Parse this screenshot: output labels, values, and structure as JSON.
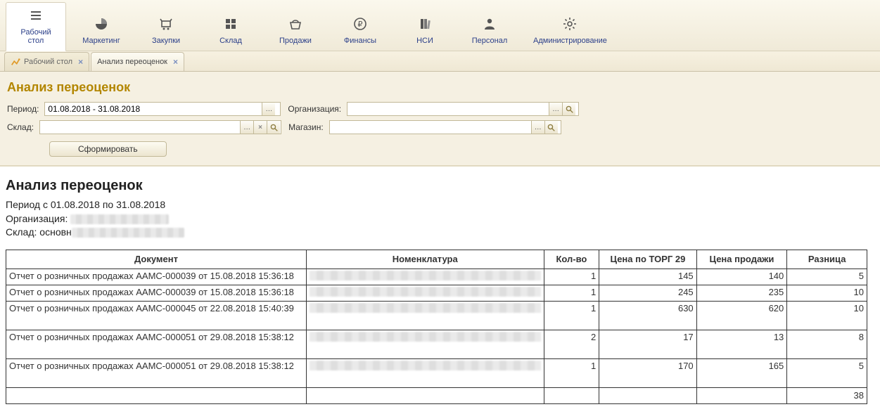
{
  "toolbar": {
    "items": [
      {
        "label_line1": "Рабочий",
        "label_line2": "стол",
        "icon": "menu",
        "active": true
      },
      {
        "label_line1": "Маркетинг",
        "label_line2": "",
        "icon": "pie",
        "active": false
      },
      {
        "label_line1": "Закупки",
        "label_line2": "",
        "icon": "cart",
        "active": false
      },
      {
        "label_line1": "Склад",
        "label_line2": "",
        "icon": "grid",
        "active": false
      },
      {
        "label_line1": "Продажи",
        "label_line2": "",
        "icon": "basket",
        "active": false
      },
      {
        "label_line1": "Финансы",
        "label_line2": "",
        "icon": "ruble",
        "active": false
      },
      {
        "label_line1": "НСИ",
        "label_line2": "",
        "icon": "books",
        "active": false
      },
      {
        "label_line1": "Персонал",
        "label_line2": "",
        "icon": "person",
        "active": false
      },
      {
        "label_line1": "Администрирование",
        "label_line2": "",
        "icon": "gear",
        "active": false
      }
    ]
  },
  "tabs": [
    {
      "label": "Рабочий стол",
      "active": false,
      "has_icon": true
    },
    {
      "label": "Анализ переоценок",
      "active": true,
      "has_icon": false
    }
  ],
  "page_title": "Анализ переоценок",
  "filters": {
    "period_label": "Период:",
    "period_value": "01.08.2018 - 31.08.2018",
    "org_label": "Организация:",
    "org_value": "",
    "sklad_label": "Склад:",
    "sklad_value": "",
    "magazin_label": "Магазин:",
    "magazin_value": "",
    "generate_btn": "Сформировать"
  },
  "report": {
    "title": "Анализ переоценок",
    "period_line": "Период с 01.08.2018 по 31.08.2018",
    "org_prefix": "Организация:",
    "sklad_prefix": "Склад: основн",
    "columns": {
      "document": "Документ",
      "nomenclature": "Номенклатура",
      "qty": "Кол-во",
      "torg_price": "Цена по ТОРГ 29",
      "sale_price": "Цена продажи",
      "diff": "Разница"
    },
    "rows": [
      {
        "document": "Отчет о розничных продажах ААМС-000039 от 15.08.2018 15:36:18",
        "qty": 1,
        "torg": 145,
        "sale": 140,
        "diff": 5
      },
      {
        "document": "Отчет о розничных продажах ААМС-000039 от 15.08.2018 15:36:18",
        "qty": 1,
        "torg": 245,
        "sale": 235,
        "diff": 10
      },
      {
        "document": "Отчет о розничных продажах ААМС-000045 от 22.08.2018 15:40:39",
        "qty": 1,
        "torg": 630,
        "sale": 620,
        "diff": 10
      },
      {
        "document": "Отчет о розничных продажах ААМС-000051 от 29.08.2018 15:38:12",
        "qty": 2,
        "torg": 17,
        "sale": 13,
        "diff": 8
      },
      {
        "document": "Отчет о розничных продажах ААМС-000051 от 29.08.2018 15:38:12",
        "qty": 1,
        "torg": 170,
        "sale": 165,
        "diff": 5
      }
    ],
    "total_diff": 38
  }
}
